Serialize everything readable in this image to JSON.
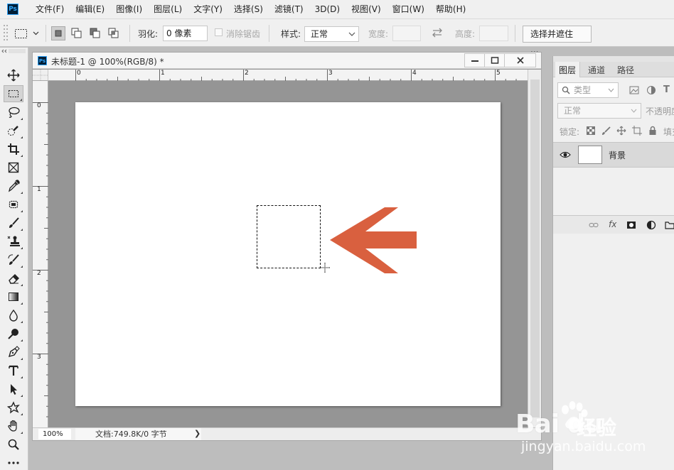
{
  "app": {
    "logo_text": "Ps",
    "menu": [
      "文件(F)",
      "编辑(E)",
      "图像(I)",
      "图层(L)",
      "文字(Y)",
      "选择(S)",
      "滤镜(T)",
      "3D(D)",
      "视图(V)",
      "窗口(W)",
      "帮助(H)"
    ]
  },
  "options": {
    "feather_label": "羽化:",
    "feather_value": "0 像素",
    "antialias_label": "消除锯齿",
    "style_label": "样式:",
    "style_value": "正常",
    "width_label": "宽度:",
    "height_label": "高度:",
    "select_mask_button": "选择并遮住 ..."
  },
  "tools": [
    {
      "name": "move-tool",
      "icon": "move-icon"
    },
    {
      "name": "rect-marquee-tool",
      "icon": "rect-marquee-icon",
      "active": true
    },
    {
      "name": "lasso-tool",
      "icon": "lasso-icon"
    },
    {
      "name": "quick-select-tool",
      "icon": "quick-select-icon"
    },
    {
      "name": "crop-tool",
      "icon": "crop-icon"
    },
    {
      "name": "frame-tool",
      "icon": "frame-icon"
    },
    {
      "name": "eyedropper-tool",
      "icon": "eyedropper-icon"
    },
    {
      "name": "healing-tool",
      "icon": "healing-icon"
    },
    {
      "name": "brush-tool",
      "icon": "brush-icon"
    },
    {
      "name": "stamp-tool",
      "icon": "stamp-icon"
    },
    {
      "name": "history-brush-tool",
      "icon": "history-brush-icon"
    },
    {
      "name": "eraser-tool",
      "icon": "eraser-icon"
    },
    {
      "name": "gradient-tool",
      "icon": "gradient-icon"
    },
    {
      "name": "blur-tool",
      "icon": "blur-icon"
    },
    {
      "name": "dodge-tool",
      "icon": "dodge-icon"
    },
    {
      "name": "pen-tool",
      "icon": "pen-icon"
    },
    {
      "name": "type-tool",
      "icon": "type-icon"
    },
    {
      "name": "path-select-tool",
      "icon": "path-select-icon"
    },
    {
      "name": "shape-tool",
      "icon": "shape-icon"
    },
    {
      "name": "hand-tool",
      "icon": "hand-icon"
    },
    {
      "name": "zoom-tool",
      "icon": "zoom-icon"
    },
    {
      "name": "more-tools",
      "icon": "more-icon"
    }
  ],
  "document": {
    "ps_icon": "Ps",
    "title": "未标题-1 @ 100%(RGB/8) *",
    "ruler_top": [
      "0",
      "1",
      "2",
      "3",
      "4",
      "5"
    ],
    "ruler_left": [
      "0",
      "1",
      "2",
      "3"
    ],
    "zoom": "100%",
    "info": "文档:749.8K/0 字节",
    "status_arrow": "❯"
  },
  "annotation": {
    "arrow_color": "#d9603f"
  },
  "layers_panel": {
    "tabs": [
      "图层",
      "通道",
      "路径"
    ],
    "filter_label": "类型",
    "blend_mode": "正常",
    "opacity_label": "不透明度",
    "lock_label": "锁定:",
    "fill_label": "填充",
    "layer_name": "背景"
  },
  "watermark": {
    "brand": "Bai du",
    "product": "经验",
    "url": "jingyan.baidu.com"
  }
}
